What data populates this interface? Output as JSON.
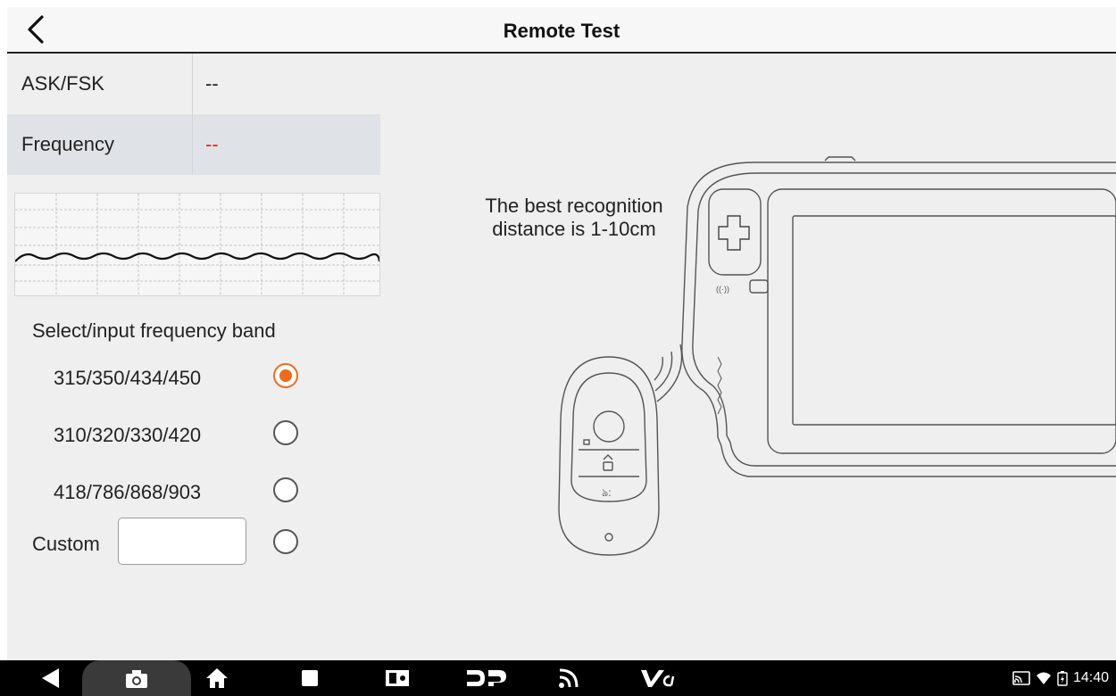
{
  "header": {
    "title": "Remote Test"
  },
  "info_table": [
    {
      "label": "ASK/FSK",
      "value": "--"
    },
    {
      "label": "Frequency",
      "value": "--"
    }
  ],
  "frequency_section": {
    "label": "Select/input frequency band",
    "options": [
      {
        "label": "315/350/434/450",
        "selected": true
      },
      {
        "label": "310/320/330/420",
        "selected": false
      },
      {
        "label": "418/786/868/903",
        "selected": false
      }
    ],
    "custom": {
      "label": "Custom",
      "value": "",
      "selected": false
    }
  },
  "hint": {
    "line1": "The best recognition",
    "line2": "distance is 1-10cm"
  },
  "colors": {
    "accent": "#f06a1a",
    "frequency_value": "#e0271a",
    "header_border": "#222222"
  },
  "navbar": {
    "items": [
      "back-icon",
      "screenshot-icon",
      "home-icon",
      "recent-apps-icon",
      "screen-mirror-icon",
      "dp-icon",
      "wireless-icon",
      "vci-icon"
    ],
    "status": {
      "time": "14:40"
    }
  }
}
